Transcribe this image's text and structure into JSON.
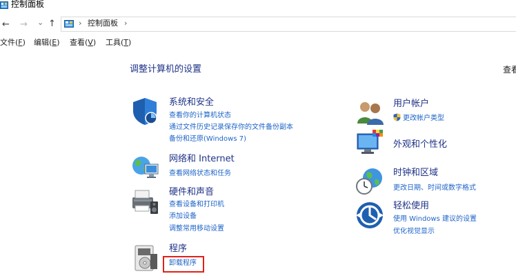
{
  "window": {
    "title": "控制面板"
  },
  "nav": {
    "back": "←",
    "forward": "→",
    "recent": "⌄",
    "up": "↑",
    "sep1": "›",
    "crumb": "控制面板",
    "sep2": "›"
  },
  "menu": [
    {
      "label": "文件(",
      "key": "F",
      "end": ")"
    },
    {
      "label": "编辑(",
      "key": "E",
      "end": ")"
    },
    {
      "label": "查看(",
      "key": "V",
      "end": ")"
    },
    {
      "label": "工具(",
      "key": "T",
      "end": ")"
    }
  ],
  "main": {
    "title": "调整计算机的设置",
    "view_by": "查看"
  },
  "categories": {
    "system": {
      "title": "系统和安全",
      "links": [
        "查看你的计算机状态",
        "通过文件历史记录保存你的文件备份副本",
        "备份和还原(Windows 7)"
      ]
    },
    "network": {
      "title": "网络和 Internet",
      "links": [
        "查看网络状态和任务"
      ]
    },
    "hardware": {
      "title": "硬件和声音",
      "links": [
        "查看设备和打印机",
        "添加设备",
        "调整常用移动设置"
      ]
    },
    "programs": {
      "title": "程序",
      "links": [
        "卸载程序"
      ]
    },
    "accounts": {
      "title": "用户帐户",
      "links": [
        "更改帐户类型"
      ]
    },
    "appearance": {
      "title": "外观和个性化",
      "links": []
    },
    "clock": {
      "title": "时钟和区域",
      "links": [
        "更改日期、时间或数字格式"
      ]
    },
    "ease": {
      "title": "轻松使用",
      "links": [
        "使用 Windows 建议的设置",
        "优化视觉显示"
      ]
    }
  },
  "colors": {
    "title_blue": "#1e3287",
    "link_blue": "#1e64c8",
    "highlight_red": "#e0201a"
  }
}
